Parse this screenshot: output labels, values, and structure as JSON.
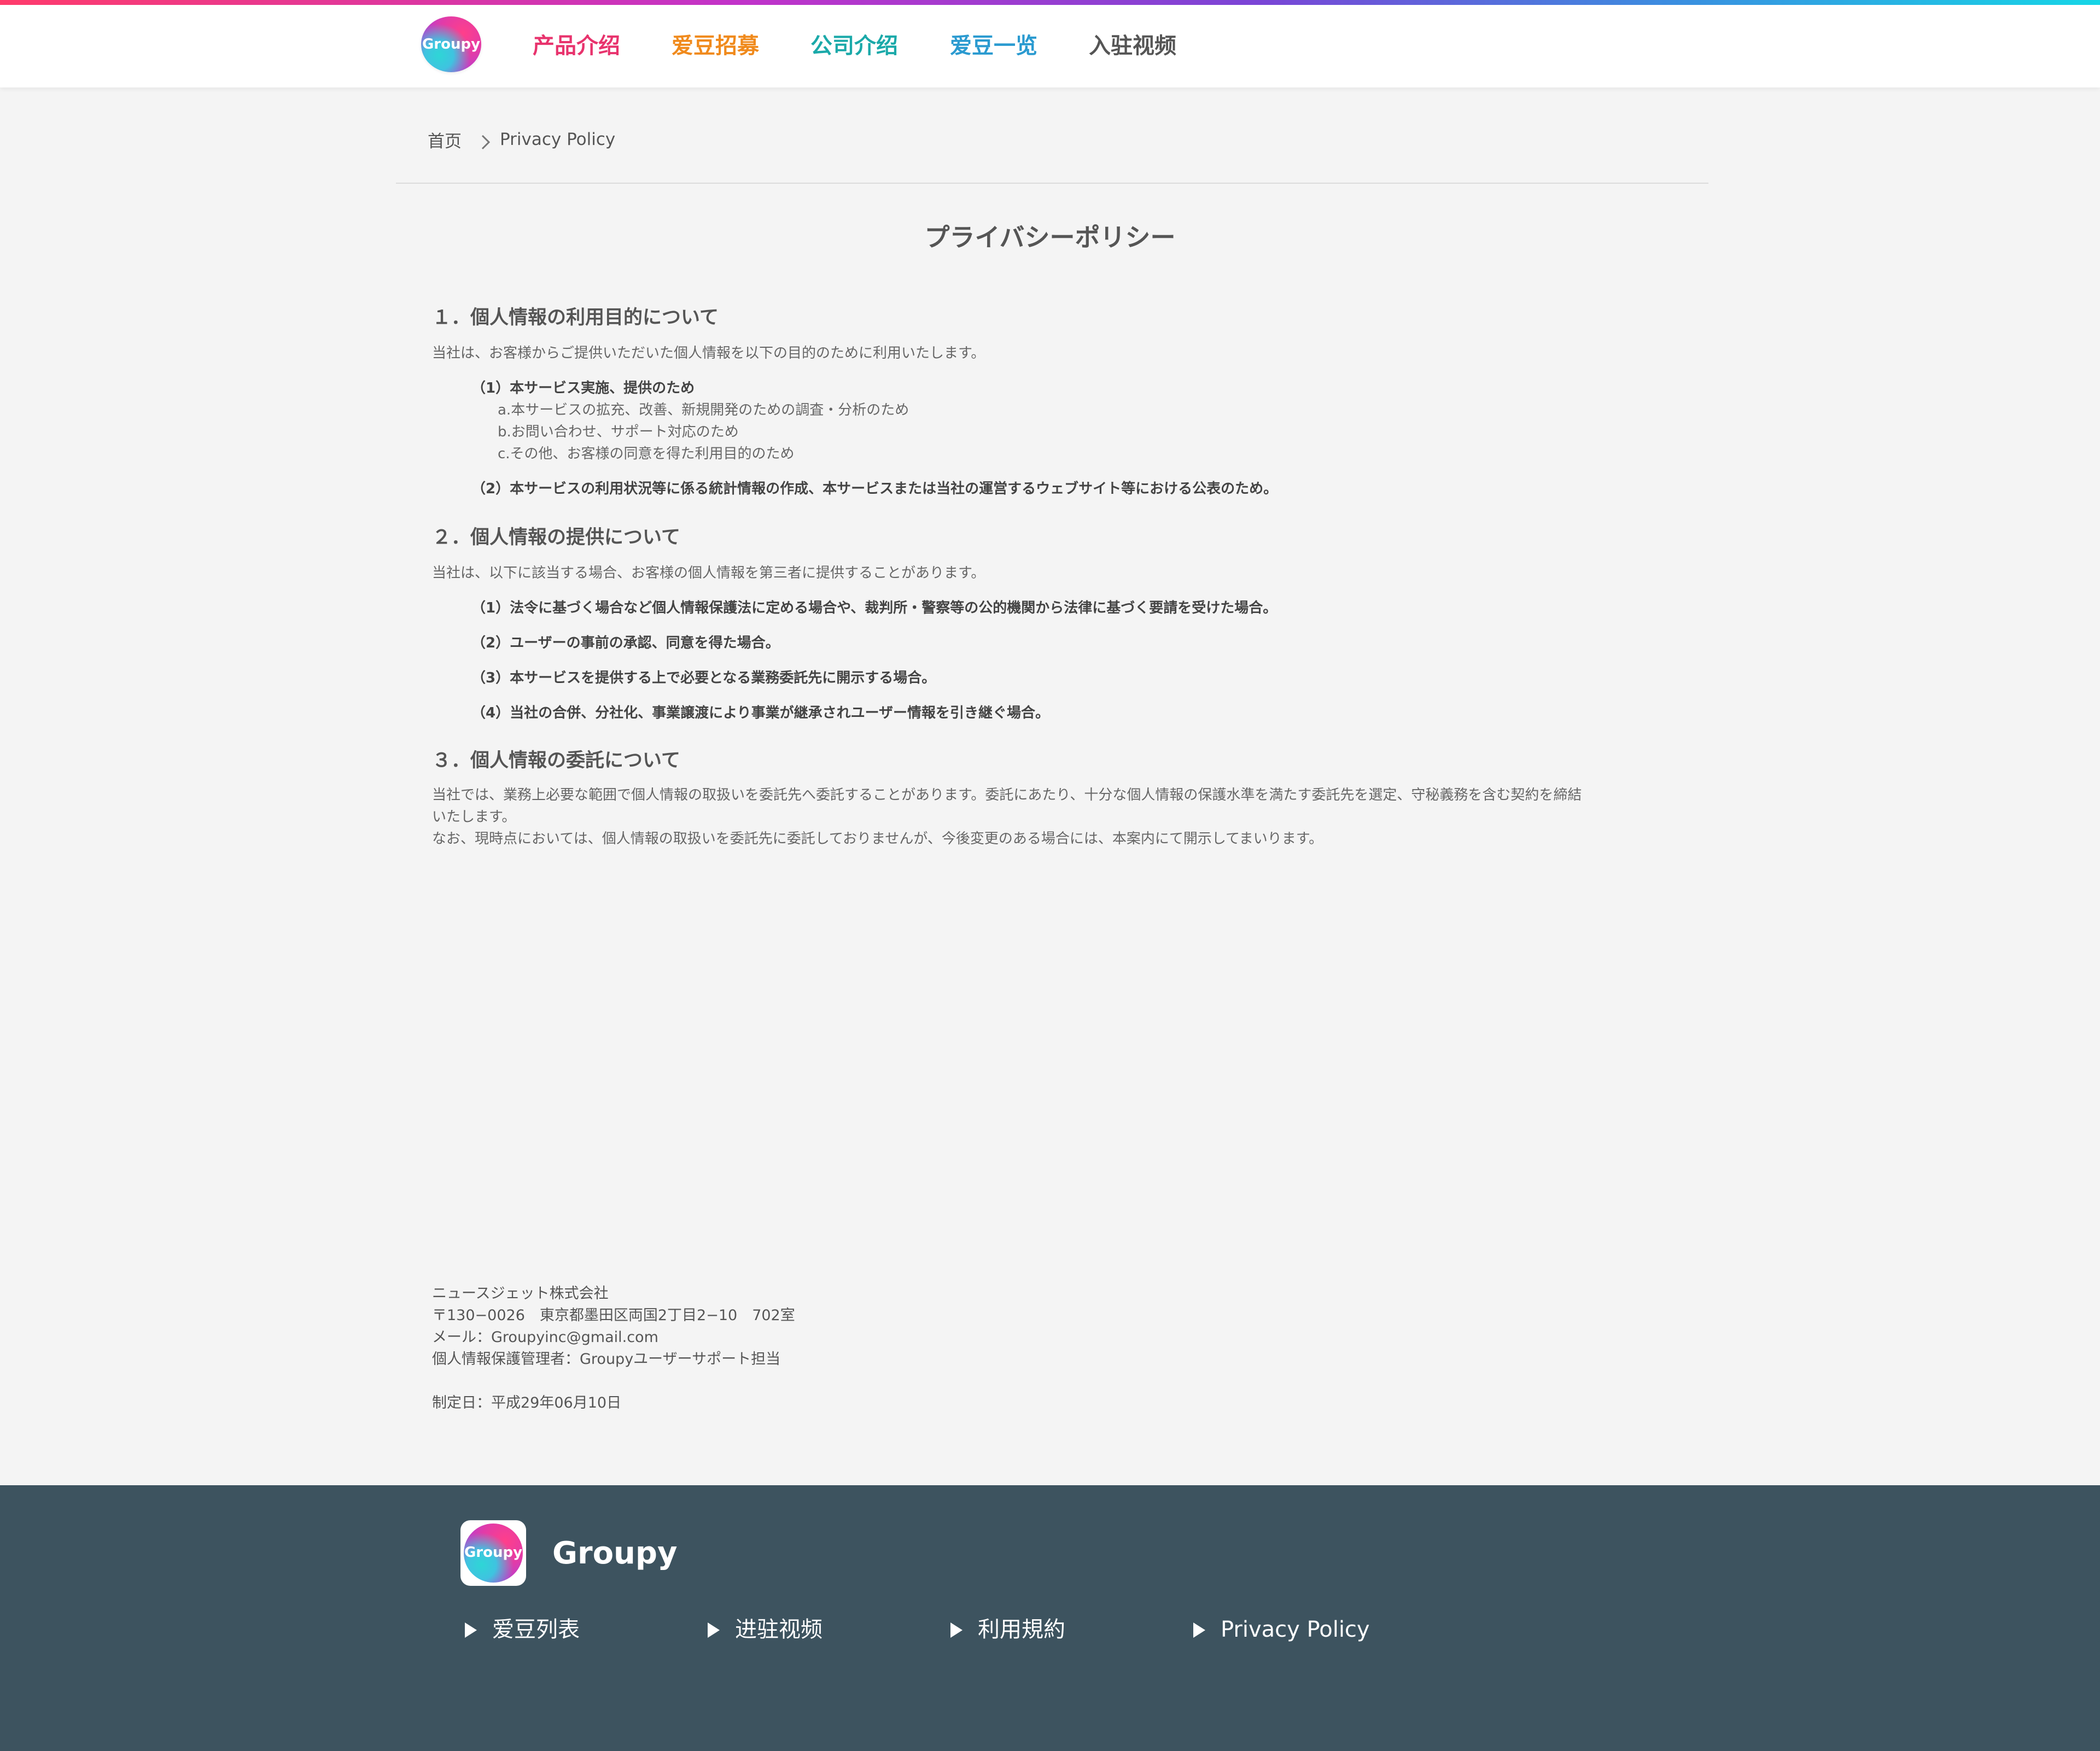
{
  "header": {
    "logo_text": "Groupy",
    "nav": [
      {
        "label": "产品介绍",
        "color": "#e8336d"
      },
      {
        "label": "爱豆招募",
        "color": "#f08a1c"
      },
      {
        "label": "公司介绍",
        "color": "#1aa9a9"
      },
      {
        "label": "爱豆一览",
        "color": "#2a9ad0"
      },
      {
        "label": "入驻视频",
        "color": "#555555"
      }
    ]
  },
  "breadcrumb": {
    "home": "首页",
    "current": "Privacy Policy"
  },
  "page": {
    "title": "プライバシーポリシー",
    "sections": [
      {
        "heading": "１．個人情報の利用目的について",
        "intro": "当社は、お客様からご提供いただいた個人情報を以下の目的のために利用いたします。",
        "items": [
          {
            "text": "（1）本サービス実施、提供のため",
            "subs": [
              "a.本サービスの拡充、改善、新規開発のための調査・分析のため",
              "b.お問い合わせ、サポート対応のため",
              "c.その他、お客様の同意を得た利用目的のため"
            ]
          },
          {
            "text": "（2）本サービスの利用状況等に係る統計情報の作成、本サービスまたは当社の運営するウェブサイト等における公表のため。",
            "subs": []
          }
        ]
      },
      {
        "heading": "２．個人情報の提供について",
        "intro": "当社は、以下に該当する場合、お客様の個人情報を第三者に提供することがあります。",
        "items": [
          {
            "text": "（1）法令に基づく場合など個人情報保護法に定める場合や、裁判所・警察等の公的機関から法律に基づく要請を受けた場合。",
            "subs": []
          },
          {
            "text": "（2）ユーザーの事前の承認、同意を得た場合。",
            "subs": []
          },
          {
            "text": "（3）本サービスを提供する上で必要となる業務委託先に開示する場合。",
            "subs": []
          },
          {
            "text": "（4）当社の合併、分社化、事業譲渡により事業が継承されユーザー情報を引き継ぐ場合。",
            "subs": []
          }
        ]
      },
      {
        "heading": "３．個人情報の委託について",
        "paragraphs": [
          "当社では、業務上必要な範囲で個人情報の取扱いを委託先へ委託することがあります。委託にあたり、十分な個人情報の保護水準を満たす委託先を選定、守秘義務を含む契約を締結",
          "いたします。",
          "なお、現時点においては、個人情報の取扱いを委託先に委託しておりませんが、今後変更のある場合には、本案内にて開示してまいります。"
        ]
      }
    ],
    "contact": {
      "company": "ニュースジェット株式会社",
      "address": "〒130−0026　東京都墨田区両国2丁目2−10　702室",
      "email": "メール：Groupyinc@gmail.com",
      "manager": "個人情報保護管理者：Groupyユーザーサポート担当",
      "established": "制定日：平成29年06月10日"
    }
  },
  "footer": {
    "logo_text": "Groupy",
    "brand": "Groupy",
    "links": [
      "爱豆列表",
      "进驻视频",
      "利用規約",
      "Privacy Policy"
    ]
  }
}
